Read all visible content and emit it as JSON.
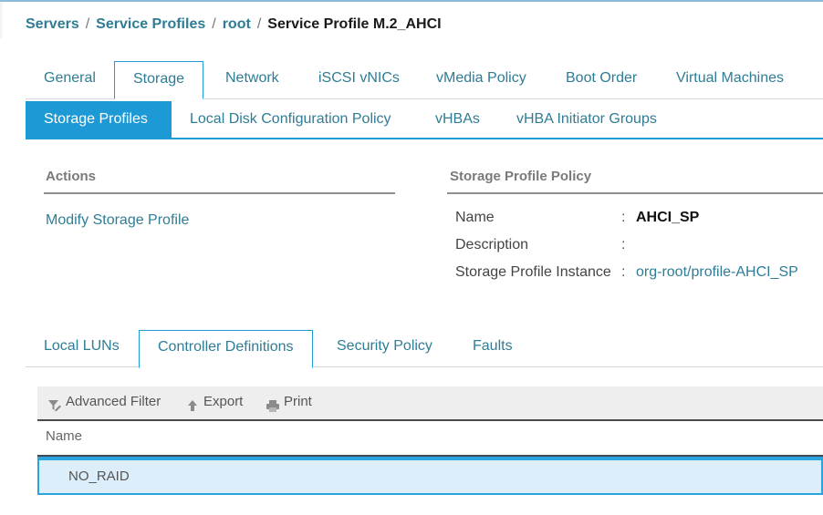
{
  "breadcrumb": {
    "items": [
      "Servers",
      "Service Profiles",
      "root"
    ],
    "separator": "/",
    "current": "Service Profile M.2_AHCI"
  },
  "primary_tabs": {
    "active": "Storage",
    "items": [
      {
        "label": "General"
      },
      {
        "label": "Storage"
      },
      {
        "label": "Network"
      },
      {
        "label": "iSCSI vNICs"
      },
      {
        "label": "vMedia Policy"
      },
      {
        "label": "Boot Order"
      },
      {
        "label": "Virtual Machines"
      }
    ]
  },
  "secondary_tabs": {
    "active": "Storage Profiles",
    "items": [
      {
        "label": "Storage Profiles"
      },
      {
        "label": "Local Disk Configuration Policy"
      },
      {
        "label": "vHBAs"
      },
      {
        "label": "vHBA Initiator Groups"
      }
    ]
  },
  "actions": {
    "title": "Actions",
    "items": [
      {
        "label": "Modify Storage Profile"
      }
    ]
  },
  "policy": {
    "title": "Storage Profile Policy",
    "fields": [
      {
        "label": "Name",
        "colon": ":",
        "value": "AHCI_SP"
      },
      {
        "label": "Description",
        "colon": ":",
        "value": ""
      },
      {
        "label": "Storage Profile Instance",
        "colon": ":",
        "value": "org-root/profile-AHCI_SP"
      }
    ]
  },
  "lower_tabs": {
    "active": "Controller Definitions",
    "items": [
      {
        "label": "Local LUNs"
      },
      {
        "label": "Controller Definitions"
      },
      {
        "label": "Security Policy"
      },
      {
        "label": "Faults"
      }
    ]
  },
  "toolbar": {
    "advanced_filter_label": "Advanced Filter",
    "export_label": "Export",
    "print_label": "Print",
    "icons": {
      "advanced_filter": "filter-icon",
      "export": "arrow-up-icon",
      "print": "printer-icon"
    }
  },
  "table": {
    "columns": [
      "Name"
    ],
    "rows": [
      {
        "name": "NO_RAID",
        "selected": true
      }
    ]
  },
  "colors": {
    "accent": "#1d9ad6",
    "link": "#2f7c95",
    "selected_row_bg": "#dbeef9"
  }
}
